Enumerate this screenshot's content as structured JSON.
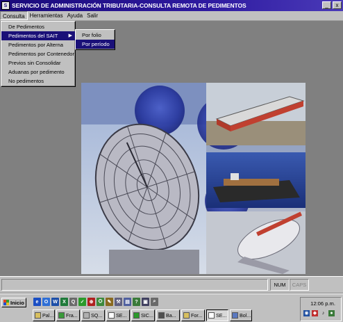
{
  "window": {
    "title": "SERVICIO DE ADMINISTRACIÓN TRIBUTARIA-CONSULTA REMOTA DE PEDIMENTOS",
    "minimize_glyph": "_",
    "close_glyph": "x"
  },
  "menubar": {
    "items": [
      "Consulta",
      "Herramientas",
      "Ayuda",
      "Salir"
    ]
  },
  "dropdown": {
    "items": [
      "De Pedimentos",
      "Pedimentos del SAIT",
      "Pedimentos por Alterna",
      "Pedimentos por Contenedor",
      "Previos sin Consolidar",
      "Aduanas por pedimento",
      "No pedimentos"
    ],
    "submenu_arrow": "▶"
  },
  "submenu": {
    "items": [
      "Por folio",
      "Por período"
    ]
  },
  "statusbar": {
    "num": "NUM",
    "caps": "CAPS"
  },
  "taskbar": {
    "start_label": "Inicio",
    "quick_launch": [
      {
        "icon": "ie-icon",
        "color": "#1b4fc4",
        "glyph": "e"
      },
      {
        "icon": "outlook-icon",
        "color": "#2f6fd6",
        "glyph": "O"
      },
      {
        "icon": "word-icon",
        "color": "#1d4fa8",
        "glyph": "W"
      },
      {
        "icon": "excel-icon",
        "color": "#1f7a3a",
        "glyph": "X"
      },
      {
        "icon": "find-icon",
        "color": "#6a6a6a",
        "glyph": "Q"
      },
      {
        "icon": "check-icon",
        "color": "#2b9a2b",
        "glyph": "✓"
      },
      {
        "icon": "antivirus-icon",
        "color": "#b02020",
        "glyph": "⊕"
      },
      {
        "icon": "network-icon",
        "color": "#3d8a3d",
        "glyph": "⛭"
      },
      {
        "icon": "pen-icon",
        "color": "#8a6a20",
        "glyph": "✎"
      },
      {
        "icon": "tools-icon",
        "color": "#606080",
        "glyph": "⚒"
      },
      {
        "icon": "doc-icon",
        "color": "#5060a0",
        "glyph": "▤"
      },
      {
        "icon": "help-icon",
        "color": "#3a7a3a",
        "glyph": "?"
      },
      {
        "icon": "window-icon",
        "color": "#404060",
        "glyph": "▣"
      },
      {
        "icon": "zoom-icon",
        "color": "#6a6a6a",
        "glyph": "⌕"
      }
    ],
    "tasks": [
      {
        "label": "Pal...",
        "icon": "folder-icon",
        "color": "#d8c060"
      },
      {
        "label": "Fra...",
        "icon": "app-icon",
        "color": "#3a9a3a"
      },
      {
        "label": "SQ...",
        "icon": "sql-icon",
        "color": "#b0b0b0"
      },
      {
        "label": "SE...",
        "icon": "sat-icon",
        "color": "#ffffff"
      },
      {
        "label": "SIC...",
        "icon": "check-icon",
        "color": "#2b9a2b"
      },
      {
        "label": "Ba...",
        "icon": "database-icon",
        "color": "#505050"
      },
      {
        "label": "For...",
        "icon": "form-icon",
        "color": "#d8c060"
      },
      {
        "label": "SE...",
        "icon": "sat-icon",
        "color": "#ffffff"
      },
      {
        "label": "Bol...",
        "icon": "doc-icon",
        "color": "#5a78c0"
      }
    ],
    "clock": "12:06 p.m."
  },
  "colors": {
    "title_bar": "#1a0a7a",
    "menu_highlight": "#1a1078",
    "desktop": "#808080",
    "chrome": "#c0c0c0"
  }
}
